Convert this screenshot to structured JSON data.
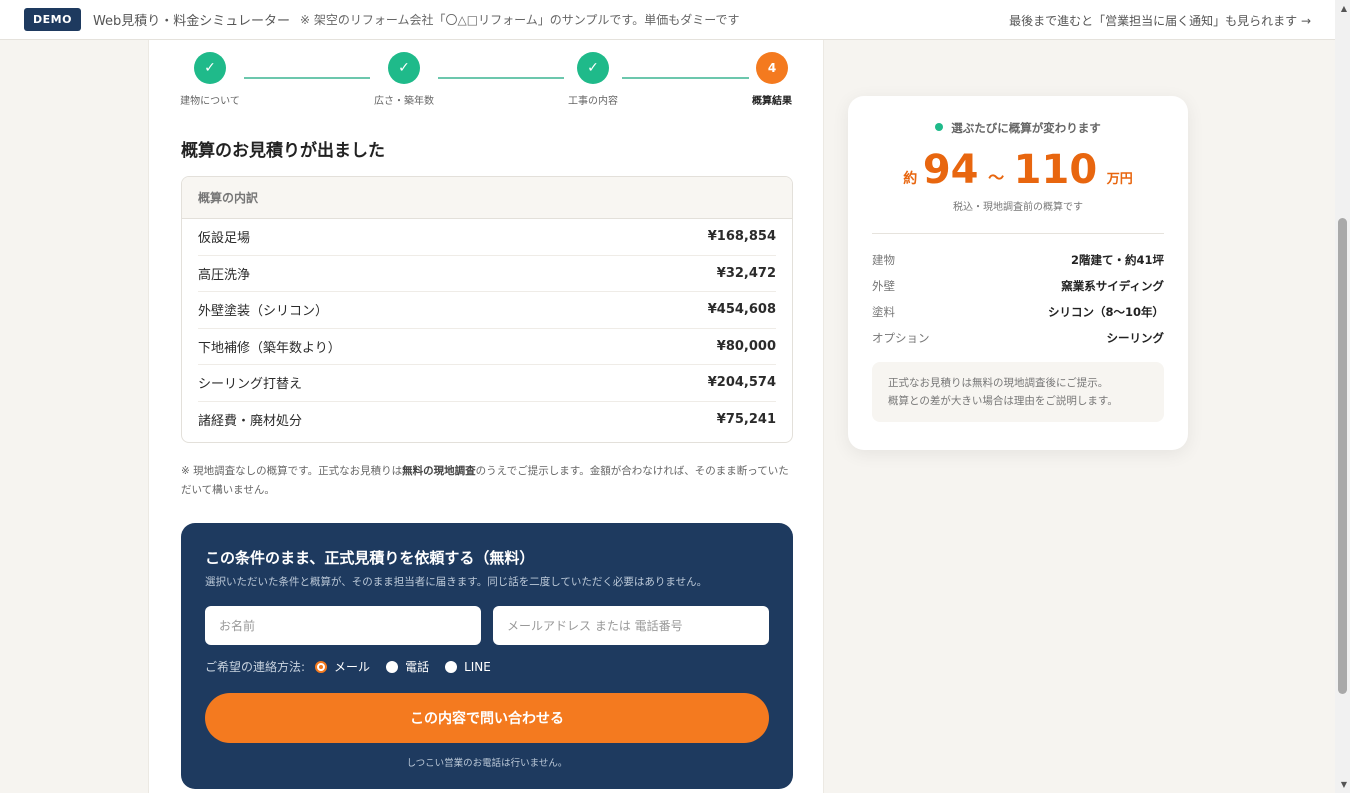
{
  "topbar": {
    "badge": "DEMO",
    "title": "Web見積り・料金シミュレーター",
    "note": "※ 架空のリフォーム会社「〇△□リフォーム」のサンプルです。単価もダミーです",
    "right_link": "最後まで進むと「営業担当に届く通知」も見られます →"
  },
  "steps": [
    {
      "label": "建物について",
      "icon": "check-icon",
      "state": "done"
    },
    {
      "label": "広さ・築年数",
      "icon": "check-icon",
      "state": "done"
    },
    {
      "label": "工事の内容",
      "icon": "check-icon",
      "state": "done"
    },
    {
      "label": "概算結果",
      "number": "4",
      "state": "active"
    }
  ],
  "result": {
    "title": "概算のお見積りが出ました",
    "breakdown_header": "概算の内訳",
    "items": [
      {
        "name": "仮設足場",
        "price": "¥168,854"
      },
      {
        "name": "高圧洗浄",
        "price": "¥32,472"
      },
      {
        "name": "外壁塗装（シリコン）",
        "price": "¥454,608"
      },
      {
        "name": "下地補修（築年数より）",
        "price": "¥80,000"
      },
      {
        "name": "シーリング打替え",
        "price": "¥204,574"
      },
      {
        "name": "諸経費・廃材処分",
        "price": "¥75,241"
      }
    ],
    "note_before": "※ 現地調査なしの概算です。正式なお見積りは",
    "note_bold": "無料の現地調査",
    "note_after": "のうえでご提示します。金額が合わなければ、そのまま断っていただいて構いません。"
  },
  "cta": {
    "title": "この条件のまま、正式見積りを依頼する（無料）",
    "subtitle": "選択いただいた条件と概算が、そのまま担当者に届きます。同じ話を二度していただく必要はありません。",
    "name_placeholder": "お名前",
    "contact_placeholder": "メールアドレス または 電話番号",
    "contact_method_label": "ご希望の連絡方法:",
    "methods": [
      {
        "label": "メール",
        "checked": true
      },
      {
        "label": "電話",
        "checked": false
      },
      {
        "label": "LINE",
        "checked": false
      }
    ],
    "submit_label": "この内容で問い合わせる",
    "footnote": "しつこい営業のお電話は行いません。"
  },
  "summary": {
    "live_label": "選ぶたびに概算が変わります",
    "price_prefix": "約",
    "price_min": "94",
    "price_tilde": "〜",
    "price_max": "110",
    "price_unit": "万円",
    "price_note": "税込・現地調査前の概算です",
    "specs": [
      {
        "key": "建物",
        "value": "2階建て・約41坪"
      },
      {
        "key": "外壁",
        "value": "窯業系サイディング"
      },
      {
        "key": "塗料",
        "value": "シリコン（8〜10年）"
      },
      {
        "key": "オプション",
        "value": "シーリング"
      }
    ],
    "info_line1": "正式なお見積りは無料の現地調査後にご提示。",
    "info_line2": "概算との差が大きい場合は理由をご説明します。"
  },
  "colors": {
    "accent": "#f47a1f",
    "navy": "#1e3a5f",
    "success": "#1fba8a"
  }
}
